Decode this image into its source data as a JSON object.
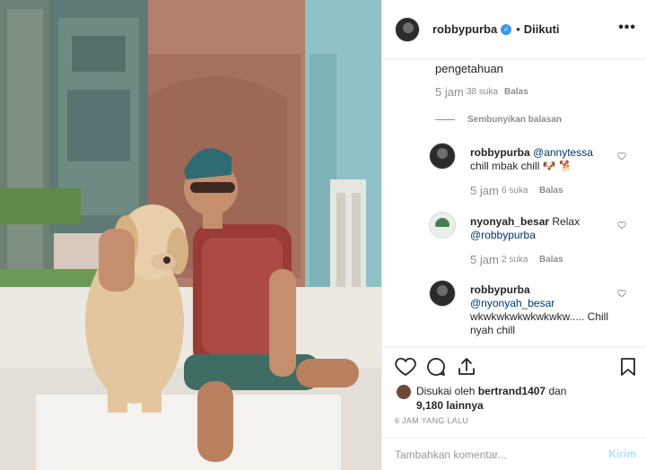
{
  "post": {
    "username": "robbypurba",
    "follow_separator": "•",
    "follow_status": "Diikuti",
    "more_label": "•••",
    "verified_icon": "verified-badge-icon",
    "accent_color": "#3897f0"
  },
  "comments": {
    "partial_text": "pengetahuan",
    "partial_meta": {
      "time": "5 jam",
      "likes": "38 suka",
      "reply": "Balas"
    },
    "hide_replies_label": "Sembunyikan balasan",
    "replies": [
      {
        "username": "robbypurba",
        "mention": "@annytessa",
        "text": "chill mbak chill 🐶 🐕",
        "time": "5 jam",
        "likes": "6 suka",
        "reply": "Balas"
      },
      {
        "username": "nyonyah_besar",
        "text_before": "Relax",
        "mention": "@robbypurba",
        "time": "5 jam",
        "likes": "2 suka",
        "reply": "Balas"
      },
      {
        "username": "robbypurba",
        "mention": "@nyonyah_besar",
        "text": "wkwkwkwkwkwkwkw..... Chill nyah chill"
      }
    ]
  },
  "actions": {
    "like_icon": "heart-icon",
    "comment_icon": "comment-icon",
    "share_icon": "share-icon",
    "save_icon": "bookmark-icon"
  },
  "likes": {
    "prefix": "Disukai oleh",
    "first_user": "bertrand1407",
    "connector": "dan",
    "others": "9,180 lainnya"
  },
  "timestamp": "6 JAM YANG LALU",
  "composer": {
    "placeholder": "Tambahkan komentar...",
    "post_label": "Kirim"
  }
}
